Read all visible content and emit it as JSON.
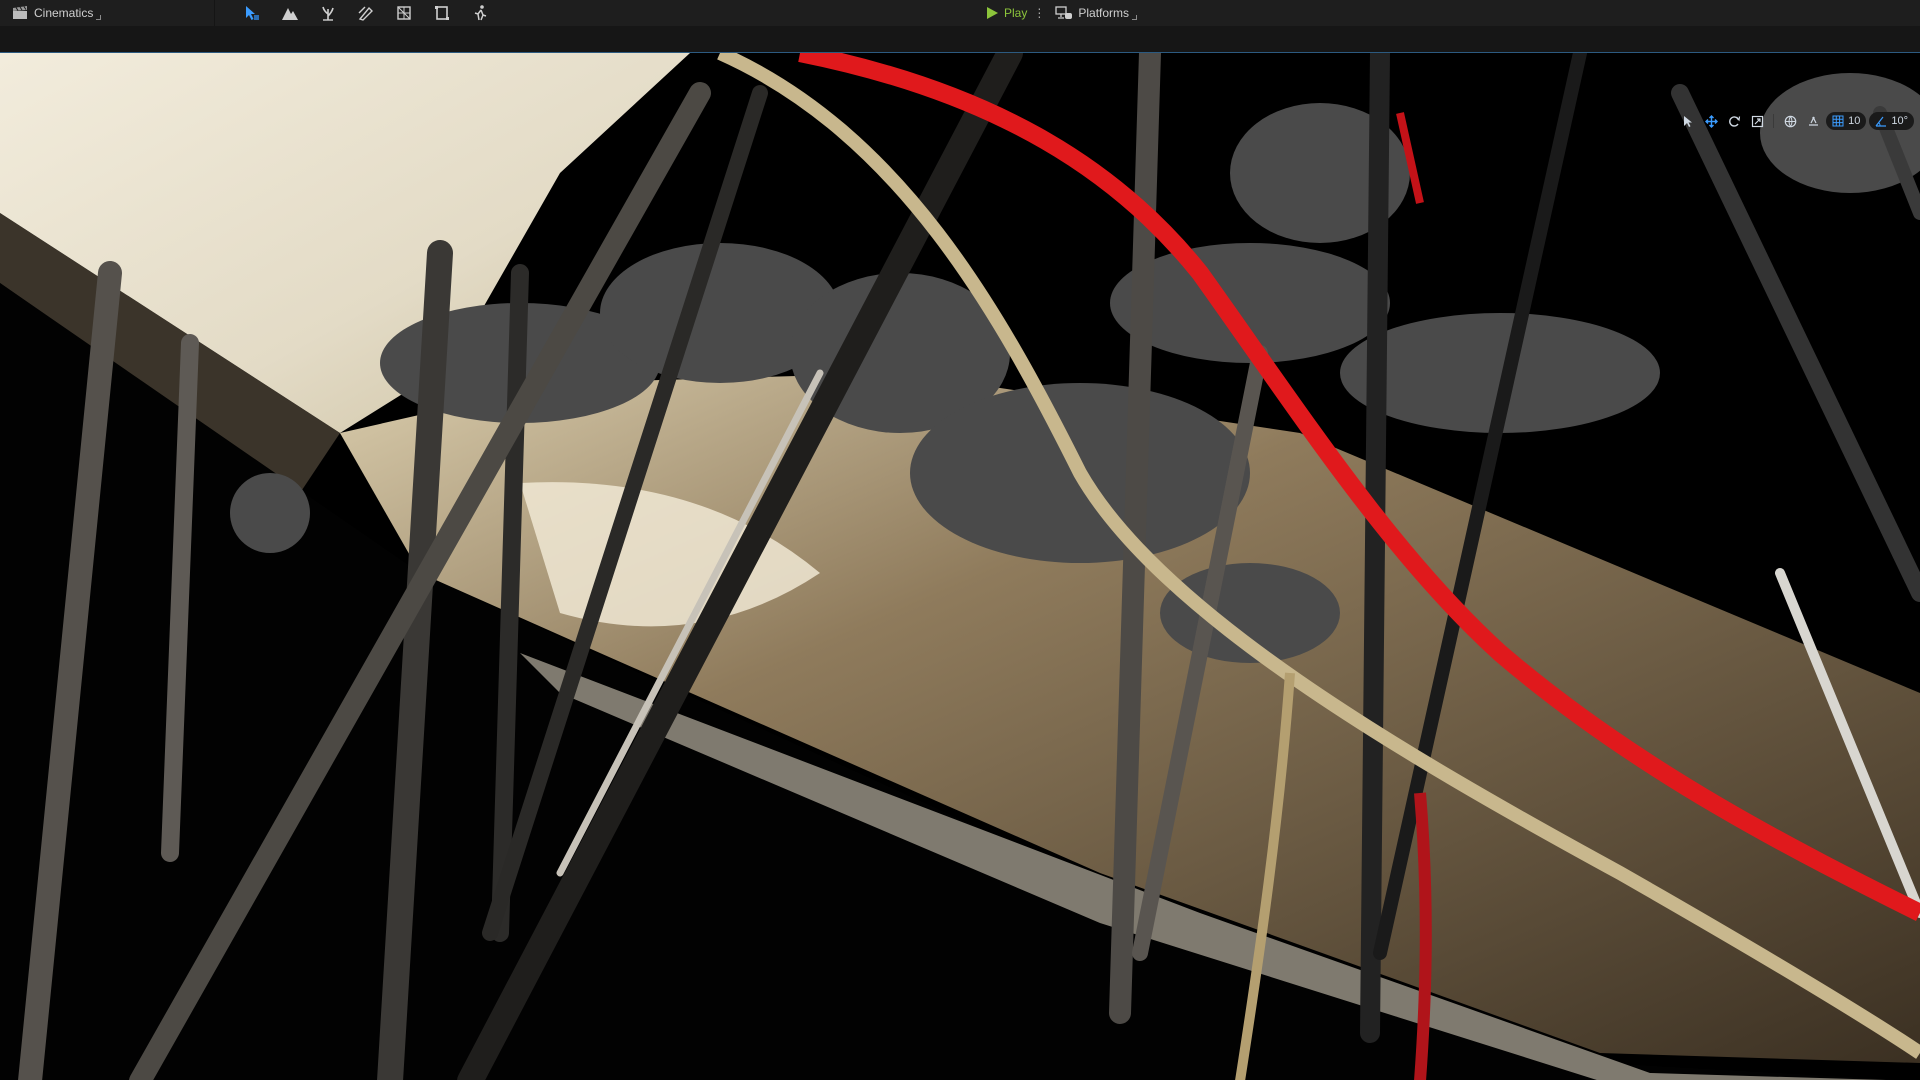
{
  "toolbar": {
    "cinematics_label": "Cinematics",
    "mode_icons": [
      "select-mode-icon",
      "landscape-mode-icon",
      "foliage-mode-icon",
      "mesh-paint-mode-icon",
      "fracture-mode-icon",
      "modeling-mode-icon",
      "animation-mode-icon"
    ],
    "play_label": "Play",
    "platforms_label": "Platforms",
    "accent_play": "#8cc43b"
  },
  "viewport_toolbar": {
    "grid_snap_value": "10",
    "rotation_snap_value": "10°",
    "active_color": "#3b9cff"
  },
  "scene": {
    "description_colors": {
      "fabric_light": "#e9e2d2",
      "fabric_shade": "#6d5c43",
      "red_cable": "#e0191c",
      "beige_cable": "#c8b78d",
      "rods": "#3d3b38"
    }
  }
}
